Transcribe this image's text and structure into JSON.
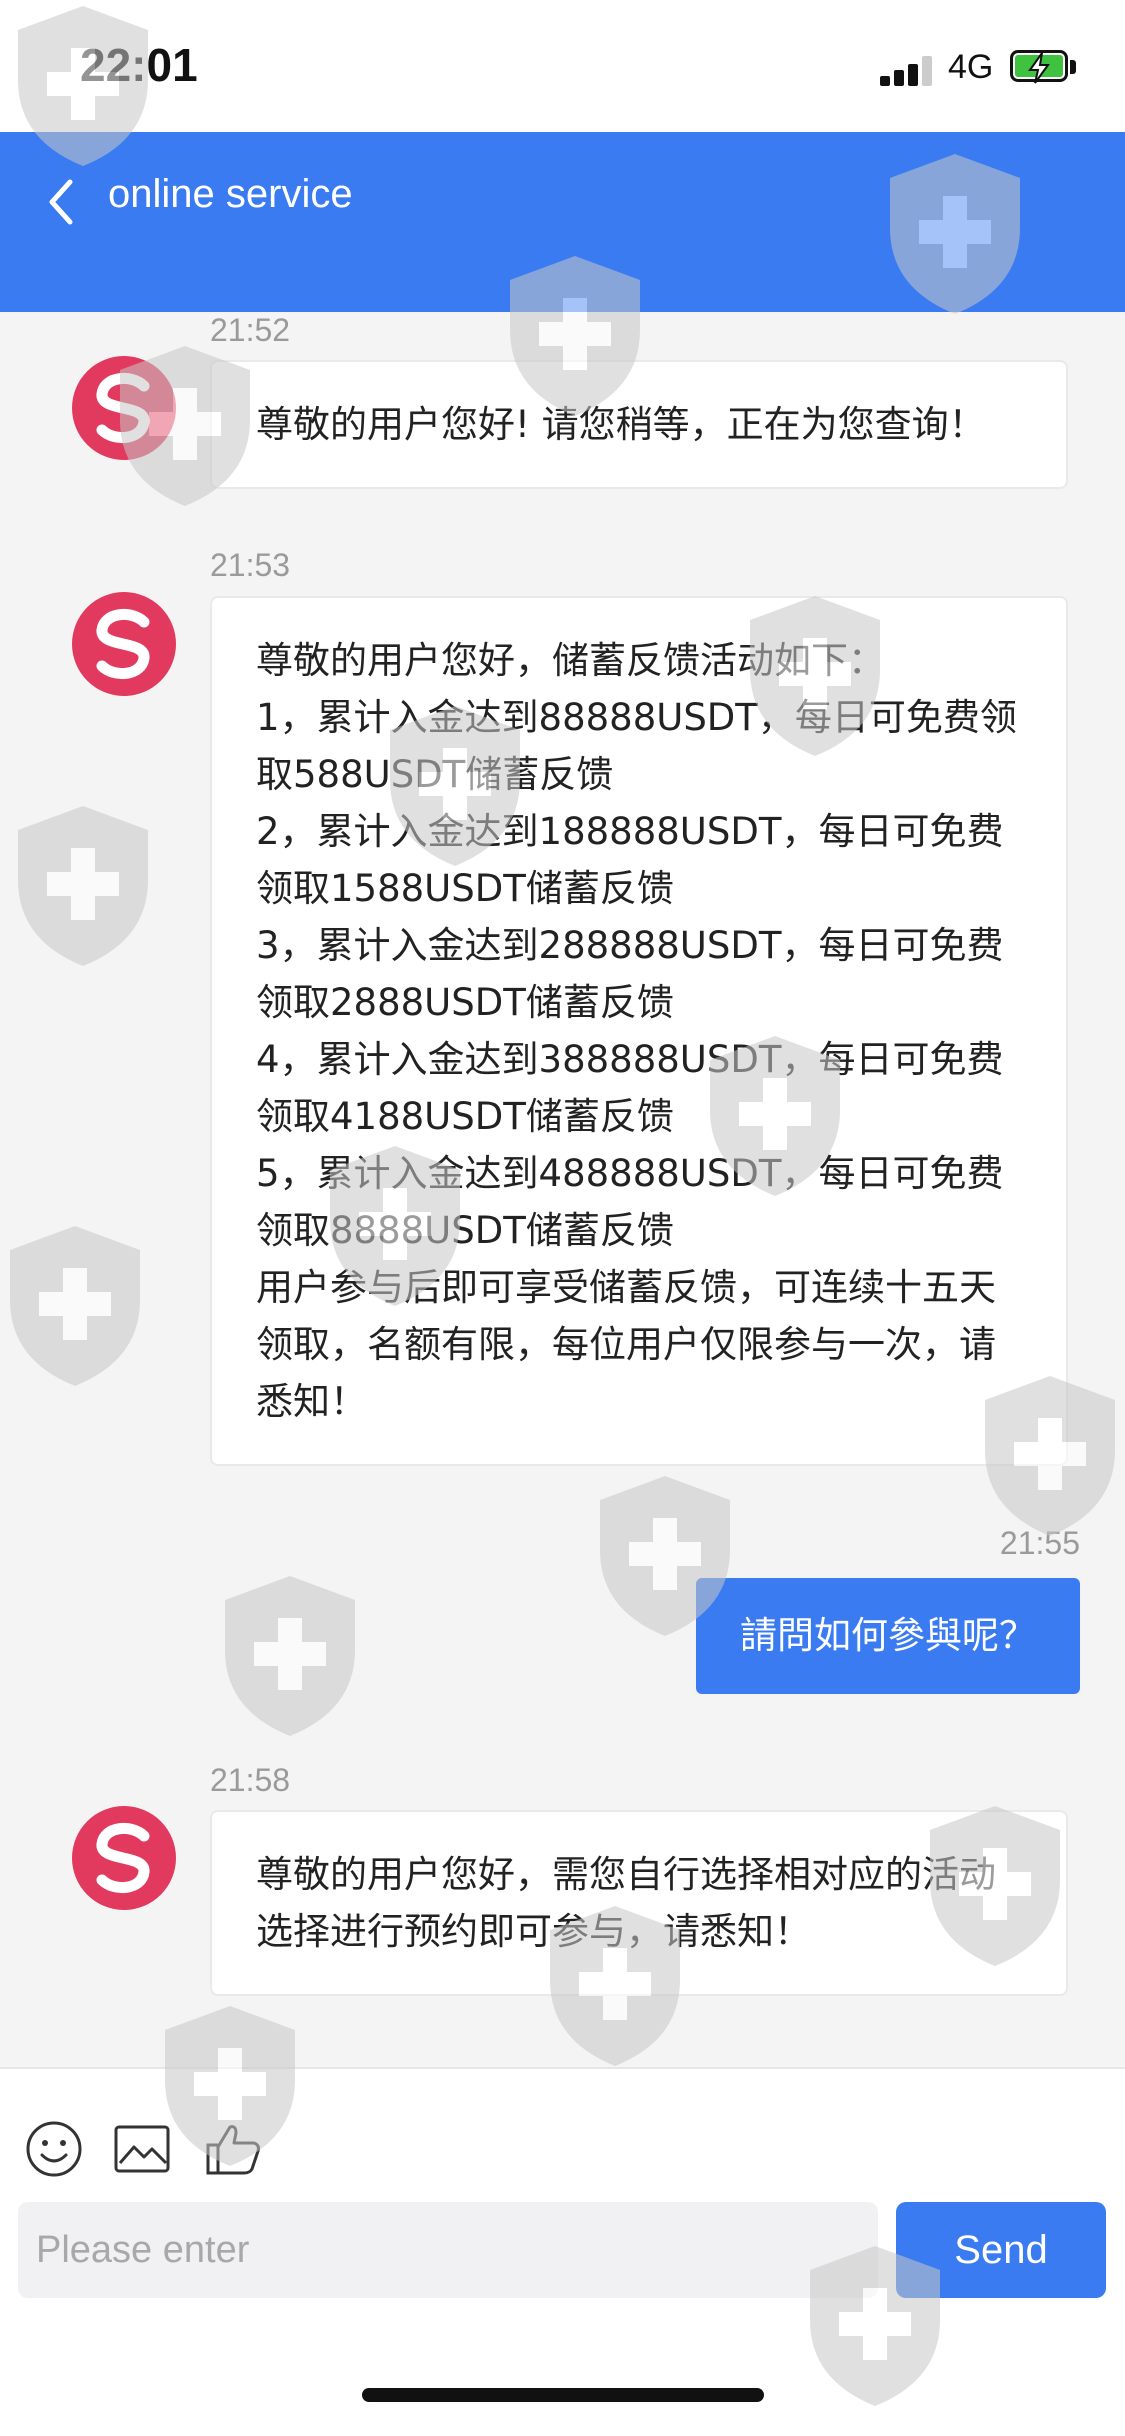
{
  "status_bar": {
    "time": "22:01",
    "network": "4G"
  },
  "header": {
    "title": "online service",
    "back_icon": "chevron-left-icon"
  },
  "messages": [
    {
      "sender": "agent",
      "time": "21:52",
      "text": "尊敬的用户您好! 请您稍等，正在为您查询！"
    },
    {
      "sender": "agent",
      "time": "21:53",
      "text": "尊敬的用户您好，储蓄反馈活动如下：\n1，累计入金达到88888USDT，每日可免费领取588USDT储蓄反馈\n2，累计入金达到188888USDT，每日可免费领取1588USDT储蓄反馈\n3，累计入金达到288888USDT，每日可免费领取2888USDT储蓄反馈\n4，累计入金达到388888USDT，每日可免费领取4188USDT储蓄反馈\n5，累计入金达到488888USDT，每日可免费领取8888USDT储蓄反馈\n用户参与后即可享受储蓄反馈，可连续十五天领取，名额有限，每位用户仅限参与一次，请悉知！"
    },
    {
      "sender": "user",
      "time": "21:55",
      "text": "請問如何參與呢？"
    },
    {
      "sender": "agent",
      "time": "21:58",
      "text": "尊敬的用户您好，需您自行选择相对应的活动选择进行预约即可参与，请悉知！"
    }
  ],
  "toolbar": {
    "icons": [
      "emoji-icon",
      "image-icon",
      "thumbs-up-icon"
    ]
  },
  "composer": {
    "placeholder": "Please enter",
    "send_label": "Send"
  },
  "colors": {
    "primary": "#3a7bf2",
    "avatar": "#e23a5e",
    "background": "#f4f4f4"
  }
}
